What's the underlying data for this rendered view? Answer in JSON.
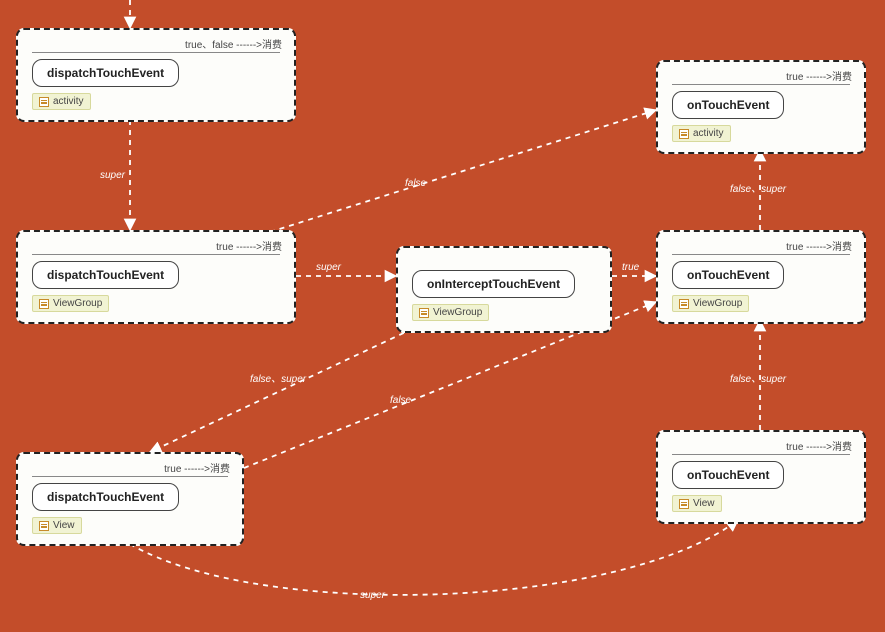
{
  "consume_suffix": "消费",
  "nodes": {
    "act_dispatch": {
      "method": "dispatchTouchEvent",
      "tag": "activity",
      "corner": "true、false ------>消费"
    },
    "vg_dispatch": {
      "method": "dispatchTouchEvent",
      "tag": "ViewGroup",
      "corner": "true ------>消费"
    },
    "view_dispatch": {
      "method": "dispatchTouchEvent",
      "tag": "View",
      "corner": "true ------>消费"
    },
    "intercept": {
      "method": "onInterceptTouchEvent",
      "tag": "ViewGroup",
      "corner": ""
    },
    "act_touch": {
      "method": "onTouchEvent",
      "tag": "activity",
      "corner": "true ------>消费"
    },
    "vg_touch": {
      "method": "onTouchEvent",
      "tag": "ViewGroup",
      "corner": "true ------>消费"
    },
    "view_touch": {
      "method": "onTouchEvent",
      "tag": "View",
      "corner": "true ------>消费"
    }
  },
  "edges": {
    "e_top_in": "",
    "e_act_to_vg": "super",
    "e_vg_to_intercept": "super",
    "e_intercept_to_vgtouch": "true",
    "e_intercept_to_viewdisp": "false、super",
    "e_vg_to_acttouch": "false",
    "e_vgtouch_to_acttouch": "false、super",
    "e_viewdisp_to_vgtouch": "false",
    "e_viewdisp_to_viewtouch": "super",
    "e_viewtouch_to_vgtouch": "false、super"
  }
}
